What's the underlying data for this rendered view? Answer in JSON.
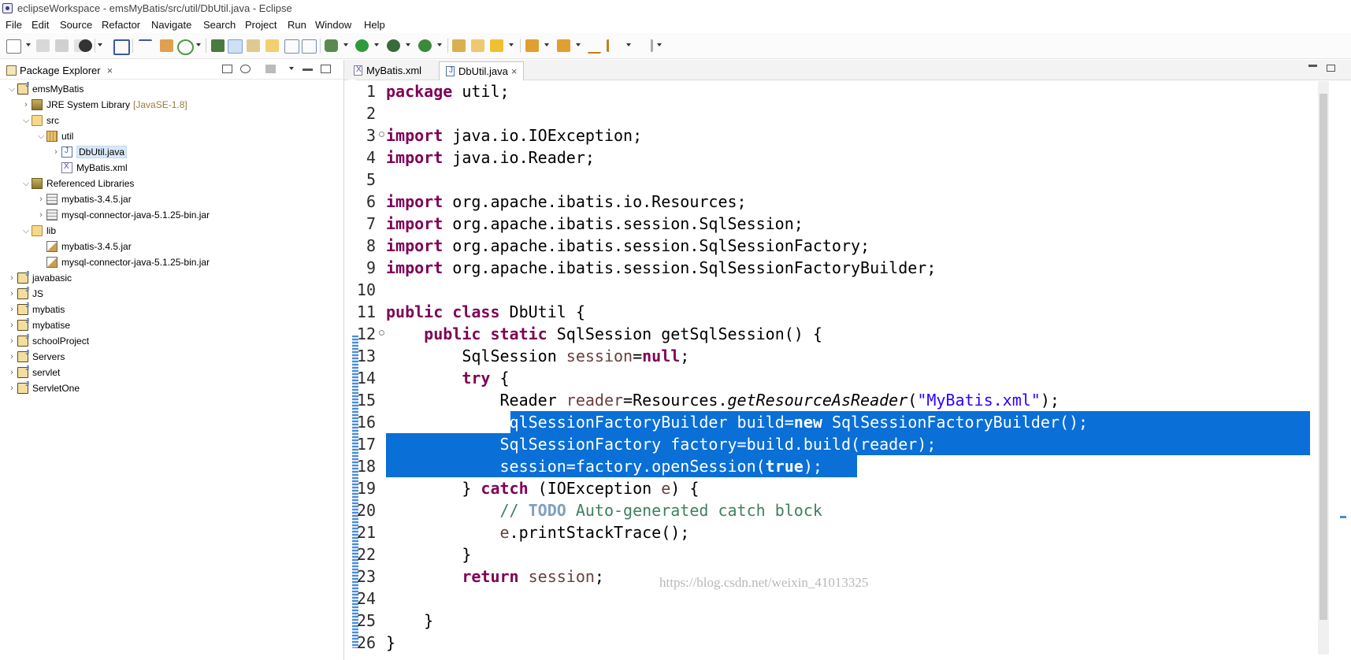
{
  "window": {
    "title": "eclipseWorkspace - emsMyBatis/src/util/DbUtil.java - Eclipse"
  },
  "menu": [
    "File",
    "Edit",
    "Source",
    "Refactor",
    "Navigate",
    "Search",
    "Project",
    "Run",
    "Window",
    "Help"
  ],
  "package_explorer": {
    "tab_label": "Package Explorer",
    "tree": [
      {
        "label": "emsMyBatis",
        "icon": "project-icon",
        "expanded": true
      },
      {
        "label": "JRE System Library",
        "extra": "[JavaSE-1.8]",
        "icon": "library-icon"
      },
      {
        "label": "src",
        "icon": "source-folder-icon",
        "expanded": true
      },
      {
        "label": "util",
        "icon": "package-icon",
        "expanded": true
      },
      {
        "label": "DbUtil.java",
        "icon": "java-file-icon",
        "selected": true
      },
      {
        "label": "MyBatis.xml",
        "icon": "xml-file-icon"
      },
      {
        "label": "Referenced Libraries",
        "icon": "library-icon",
        "expanded": true
      },
      {
        "label": "mybatis-3.4.5.jar",
        "icon": "jar-icon"
      },
      {
        "label": "mysql-connector-java-5.1.25-bin.jar",
        "icon": "jar-icon"
      },
      {
        "label": "lib",
        "icon": "folder-icon",
        "expanded": true
      },
      {
        "label": "mybatis-3.4.5.jar",
        "icon": "jar-file-icon"
      },
      {
        "label": "mysql-connector-java-5.1.25-bin.jar",
        "icon": "jar-file-icon"
      },
      {
        "label": "javabasic",
        "icon": "project-icon"
      },
      {
        "label": "JS",
        "icon": "project-icon"
      },
      {
        "label": "mybatis",
        "icon": "project-icon"
      },
      {
        "label": "mybatise",
        "icon": "project-icon"
      },
      {
        "label": "schoolProject",
        "icon": "project-icon"
      },
      {
        "label": "Servers",
        "icon": "project-icon"
      },
      {
        "label": "servlet",
        "icon": "project-icon"
      },
      {
        "label": "ServletOne",
        "icon": "project-icon"
      }
    ]
  },
  "editor": {
    "tabs": [
      {
        "label": "MyBatis.xml",
        "active": false
      },
      {
        "label": "DbUtil.java",
        "active": true
      }
    ],
    "line_numbers": [
      "1",
      "2",
      "3",
      "4",
      "5",
      "6",
      "7",
      "8",
      "9",
      "10",
      "11",
      "12",
      "13",
      "14",
      "15",
      "16",
      "17",
      "18",
      "19",
      "20",
      "21",
      "22",
      "23",
      "24",
      "25",
      "26"
    ],
    "code": {
      "l1_kw": "package",
      "l1_rest": " util;",
      "l3_kw": "import",
      "l3_rest": " java.io.IOException;",
      "l4_kw": "import",
      "l4_rest": " java.io.Reader;",
      "l6_kw": "import",
      "l6_rest": " org.apache.ibatis.io.Resources;",
      "l7_kw": "import",
      "l7_rest": " org.apache.ibatis.session.SqlSession;",
      "l8_kw": "import",
      "l8_rest": " org.apache.ibatis.session.SqlSessionFactory;",
      "l9_kw": "import",
      "l9_rest": " org.apache.ibatis.session.SqlSessionFactoryBuilder;",
      "l11_kw": "public class",
      "l11_rest": " DbUtil {",
      "l12_ind": "    ",
      "l12_kw": "public static",
      "l12_rest": " SqlSession getSqlSession() {",
      "l13_a": "        SqlSession ",
      "l13_var": "session",
      "l13_b": "=",
      "l13_kw": "null",
      "l13_c": ";",
      "l14_ind": "        ",
      "l14_kw": "try",
      "l14_rest": " {",
      "l15_a": "            Reader ",
      "l15_var": "reader",
      "l15_b": "=Resources.",
      "l15_it": "getResourceAsReader",
      "l15_c": "(",
      "l15_str": "\"MyBatis.xml\"",
      "l15_d": ");",
      "l16_ind": "            ",
      "l16_a": "SqlSessionFactoryBuilder build=",
      "l16_kw": "new",
      "l16_b": " SqlSessionFactoryBuilder();",
      "l17_ind": "            ",
      "l17_a": "SqlSessionFactory factory=build.build(reader);",
      "l18_ind": "            ",
      "l18_a": "session=factory.openSession(",
      "l18_kw": "true",
      "l18_b": ");",
      "l19_a": "        } ",
      "l19_kw": "catch",
      "l19_b": " (IOException ",
      "l19_var": "e",
      "l19_c": ") {",
      "l20_ind": "            ",
      "l20_cm1": "// ",
      "l20_todo": "TODO",
      "l20_cm2": " Auto-generated catch block",
      "l21_ind": "            ",
      "l21_var": "e",
      "l21_rest": ".printStackTrace();",
      "l22_a": "        }",
      "l23_ind": "        ",
      "l23_kw": "return",
      "l23_b": " ",
      "l23_var": "session",
      "l23_c": ";",
      "l25_a": "    }",
      "l26_a": "}"
    }
  },
  "watermark": "https://blog.csdn.net/weixin_41013325"
}
